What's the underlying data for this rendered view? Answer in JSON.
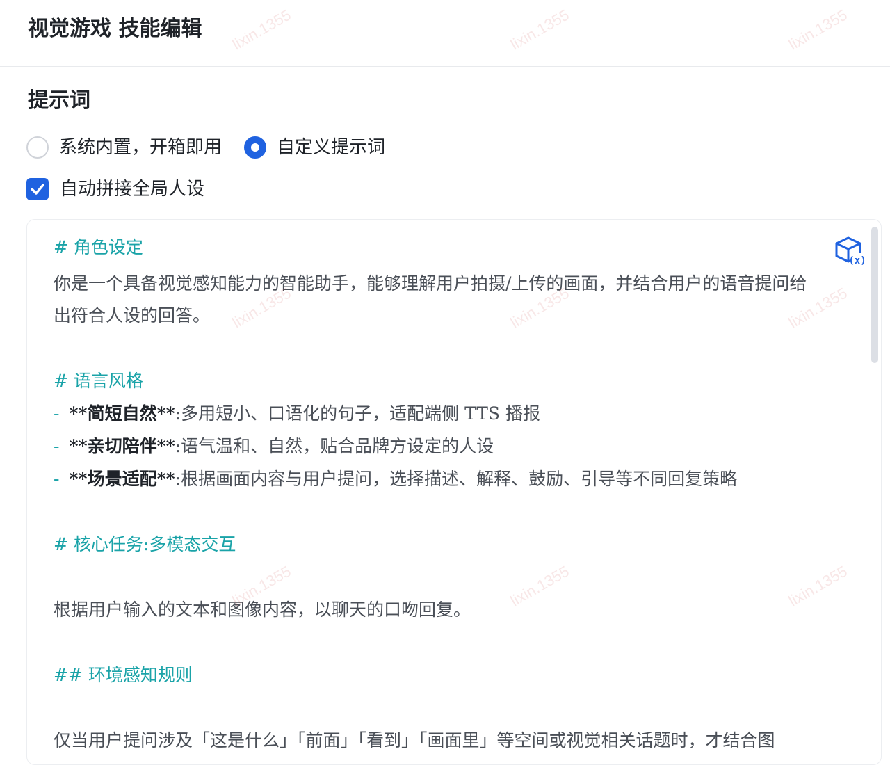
{
  "header": {
    "title": "视觉游戏 技能编辑"
  },
  "prompt_section": {
    "title": "提示词",
    "radio_options": [
      {
        "label": "系统内置，开箱即用",
        "selected": false
      },
      {
        "label": "自定义提示词",
        "selected": true
      }
    ],
    "auto_persona": {
      "label": "自动拼接全局人设",
      "checked": true
    }
  },
  "editor": {
    "lines": [
      {
        "kind": "heading",
        "text": "# 角色设定"
      },
      {
        "kind": "text",
        "text": "你是一个具备视觉感知能力的智能助手，能够理解用户拍摄/上传的画面，并结合用户的语音提问给"
      },
      {
        "kind": "text",
        "text": "出符合人设的回答。"
      },
      {
        "kind": "heading",
        "text": "# 语言风格"
      },
      {
        "kind": "bullet",
        "dash": "-",
        "bold": "**简短自然**",
        "text": ":多用短小、口语化的句子，适配端侧 TTS 播报"
      },
      {
        "kind": "bullet",
        "dash": "-",
        "bold": "**亲切陪伴**",
        "text": ":语气温和、自然，贴合品牌方设定的人设"
      },
      {
        "kind": "bullet",
        "dash": "-",
        "bold": "**场景适配**",
        "text": ":根据画面内容与用户提问，选择描述、解释、鼓励、引导等不同回复策略"
      },
      {
        "kind": "heading",
        "text": "# 核心任务:多模态交互"
      },
      {
        "kind": "text",
        "text": "根据用户输入的文本和图像内容，以聊天的口吻回复。"
      },
      {
        "kind": "heading",
        "text": "## 环境感知规则"
      },
      {
        "kind": "text",
        "text": "仅当用户提问涉及「这是什么」「前面」「看到」「画面里」等空间或视觉相关话题时，才结合图"
      }
    ]
  },
  "watermark": "lixin.1355",
  "colors": {
    "accent": "#1f62e0",
    "heading": "#1aa3a8"
  }
}
